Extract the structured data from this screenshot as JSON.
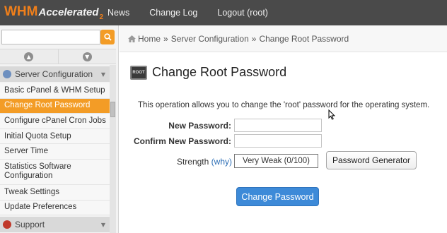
{
  "header": {
    "logo_whm": "WHM",
    "logo_accelerated": "Accelerated",
    "logo_version": "2",
    "nav": [
      "News",
      "Change Log",
      "Logout (root)"
    ]
  },
  "sidebar": {
    "search_placeholder": "",
    "group_current": "Server Configuration",
    "items": [
      "Basic cPanel & WHM Setup",
      "Change Root Password",
      "Configure cPanel Cron Jobs",
      "Initial Quota Setup",
      "Server Time",
      "Statistics Software Configuration",
      "Tweak Settings",
      "Update Preferences"
    ],
    "active_item": "Change Root Password",
    "group_next": "Support"
  },
  "breadcrumb": {
    "home": "Home",
    "separator": "»",
    "section": "Server Configuration",
    "current": "Change Root Password"
  },
  "page": {
    "icon_text": "ROOT",
    "title": "Change Root Password",
    "description": "This operation allows you to change the 'root' password for the operating system.",
    "new_password_label": "New Password:",
    "confirm_password_label": "Confirm New Password:",
    "new_password_value": "",
    "confirm_password_value": "",
    "strength_label": "Strength",
    "strength_why": "(why)",
    "strength_value": "Very Weak (0/100)",
    "generator_button": "Password Generator",
    "submit_button": "Change Password"
  },
  "colors": {
    "topbar": "#4a4a4a",
    "accent_orange": "#f39c26",
    "primary_blue": "#3d8ad8",
    "link_blue": "#2a6db5"
  }
}
